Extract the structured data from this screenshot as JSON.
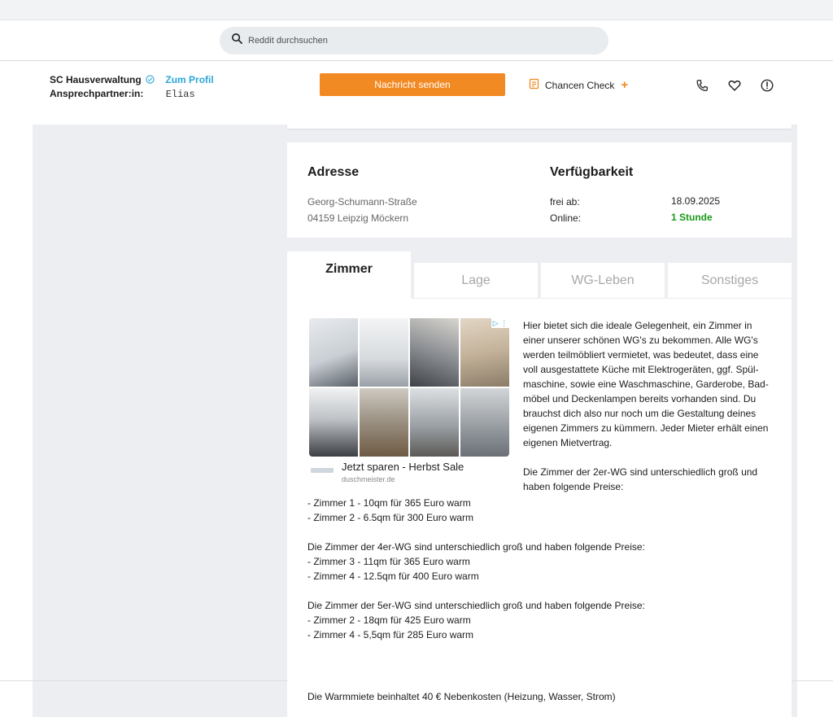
{
  "search": {
    "placeholder": "Reddit durchsuchen"
  },
  "contact": {
    "name": "SC Hausverwaltung",
    "profile_link": "Zum Profil",
    "contact_label": "Ansprechpartner:in:",
    "contact_name": "Elias",
    "message_button": "Nachricht senden",
    "chancen_label": "Chancen Check",
    "chancen_plus": "+"
  },
  "address": {
    "heading": "Adresse",
    "street": "Georg-Schumann-Straße",
    "city": "04159 Leipzig Möckern"
  },
  "availability": {
    "heading": "Verfügbarkeit",
    "free_label": "frei ab:",
    "free_value": "18.09.2025",
    "online_label": "Online:",
    "online_value": "1 Stunde"
  },
  "tabs": [
    {
      "label": "Zimmer",
      "active": true
    },
    {
      "label": "Lage",
      "active": false
    },
    {
      "label": "WG-Leben",
      "active": false
    },
    {
      "label": "Sonstiges",
      "active": false
    }
  ],
  "ad": {
    "title": "Jetzt sparen - Herbst Sale",
    "domain": "duschmeister.de",
    "badge": "▷ ⋮"
  },
  "description": {
    "intro": "Hier bietet sich die ideale Gelegenheit, ein Zimmer in einer unserer schönen WG's zu bekommen. Alle WG's werden teilmöbliert vermietet, was bedeutet, dass eine voll ausgestattete Küche mit Elektrogeräten, ggf. Spül­maschine, sowie eine Waschmaschine, Garderobe, Bad­möbel und Deckenlampen bereits vorhanden sind. Du brauchst dich also nur noch um die Gestaltung deines eigenen Zimmers zu kümmern. Jeder Mieter erhält ei­nen eigenen Mietvertrag.",
    "wg2_intro": "Die Zimmer der 2er-WG sind unterschiedlich groß und haben folgende Preise:",
    "wg2_rooms": [
      "- Zimmer 1 - 10qm für 365 Euro warm",
      "- Zimmer 2 - 6.5qm für 300 Euro warm"
    ],
    "wg4_intro": "Die Zimmer der 4er-WG sind unterschiedlich groß und haben folgende Preise:",
    "wg4_rooms": [
      "- Zimmer 3 - 11qm für 365 Euro warm",
      "- Zimmer 4 - 12.5qm für 400 Euro warm"
    ],
    "wg5_intro": "Die Zimmer der 5er-WG sind unterschiedlich groß und haben folgende Preise:",
    "wg5_rooms": [
      "- Zimmer 2 - 18qm für 425 Euro warm",
      "- Zimmer 4 - 5,5qm für 285 Euro warm"
    ],
    "warmmiete": "Die Warmmiete beinhaltet 40 € Nebenkosten (Heizung, Wasser, Strom)"
  },
  "colors": {
    "accent": "#f28a23",
    "link": "#2aa6d9",
    "online": "#1a9a1a"
  }
}
